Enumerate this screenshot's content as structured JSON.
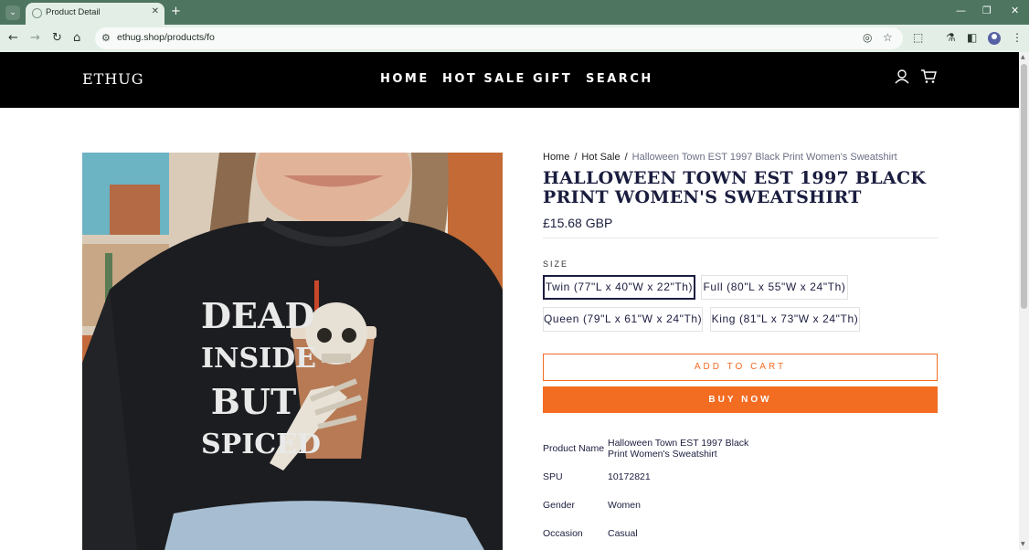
{
  "browser": {
    "tab_title": "Product Detail",
    "url": "ethug.shop/products/fo",
    "new_tab_glyph": "+",
    "close_glyph": "✕"
  },
  "site": {
    "logo": "ETHUG",
    "nav": [
      "HOME",
      "HOT SALE",
      "GIFT",
      "SEARCH"
    ]
  },
  "breadcrumb": {
    "home": "Home",
    "separator": "/",
    "category": "Hot Sale",
    "current": "Halloween Town EST 1997 Black Print Women's Sweatshirt"
  },
  "product": {
    "title": "HALLOWEEN TOWN EST 1997 BLACK PRINT WOMEN'S SWEATSHIRT",
    "price": "£15.68 GBP",
    "size_label": "SIZE",
    "sizes": [
      "Twin (77\"L x 40\"W x 22\"Th)",
      "Full (80\"L x 55\"W x 24\"Th)",
      "Queen (79\"L x 61\"W x 24\"Th)",
      "King (81\"L x 73\"W x 24\"Th)"
    ],
    "selected_size": "Twin (77\"L x 40\"W x 22\"Th)",
    "add_to_cart": "ADD TO CART",
    "buy_now": "BUY NOW",
    "image_print": [
      "DEAD",
      "INSIDE",
      "BUT",
      "SPICED"
    ],
    "attributes": [
      {
        "key": "Product Name",
        "value": "Halloween Town EST 1997 Black Print Women's Sweatshirt"
      },
      {
        "key": "SPU",
        "value": "10172821"
      },
      {
        "key": "Gender",
        "value": "Women"
      },
      {
        "key": "Occasion",
        "value": "Casual"
      }
    ]
  },
  "colors": {
    "chrome_tab": "#4e7560",
    "chrome_toolbar": "#e3efe6",
    "header_bg": "#000000",
    "accent": "#f26c22",
    "text_dark": "#1b1d3f"
  }
}
